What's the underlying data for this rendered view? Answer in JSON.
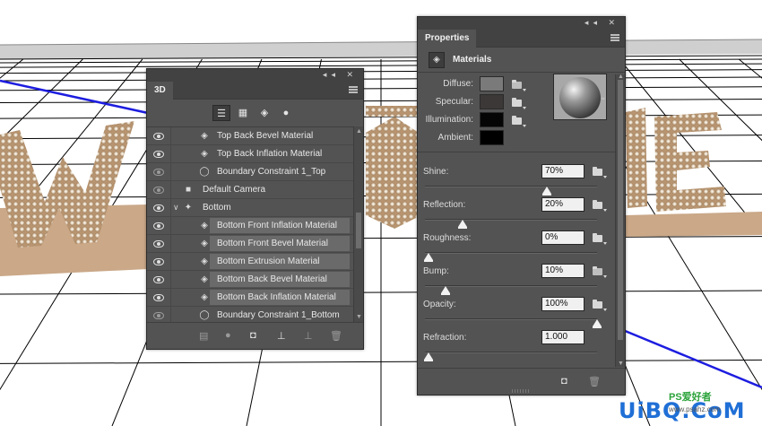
{
  "panel_3d": {
    "tab": "3D",
    "window_controls": "◂◂ ✕",
    "toolbar_icons": [
      "scene-icon",
      "mesh-icon",
      "material-icon",
      "light-icon"
    ],
    "layers": [
      {
        "label": "Top Back Bevel Material",
        "icon": "material-icon",
        "visible": true,
        "selected": false
      },
      {
        "label": "Top Back Inflation Material",
        "icon": "material-icon",
        "visible": true,
        "selected": false
      },
      {
        "label": "Boundary Constraint 1_Top",
        "icon": "constraint-icon",
        "visible": false,
        "selected": false
      },
      {
        "label": "Default Camera",
        "icon": "camera-icon",
        "visible": false,
        "selected": false
      },
      {
        "label": "Bottom",
        "icon": "mesh-icon",
        "visible": true,
        "selected": false,
        "expanded": true
      },
      {
        "label": "Bottom Front Inflation Material",
        "icon": "material-icon",
        "visible": true,
        "selected": true
      },
      {
        "label": "Bottom Front Bevel Material",
        "icon": "material-icon",
        "visible": true,
        "selected": true
      },
      {
        "label": "Bottom Extrusion Material",
        "icon": "material-icon",
        "visible": true,
        "selected": true
      },
      {
        "label": "Bottom Back Bevel Material",
        "icon": "material-icon",
        "visible": true,
        "selected": true
      },
      {
        "label": "Bottom Back Inflation Material",
        "icon": "material-icon",
        "visible": true,
        "selected": true
      },
      {
        "label": "Boundary Constraint 1_Bottom",
        "icon": "constraint-icon",
        "visible": false,
        "selected": false
      }
    ],
    "bottom_icons": [
      "render-icon",
      "light-bulb-icon",
      "new-mesh-icon",
      "ground-icon",
      "add-constraint-icon",
      "delete-icon"
    ]
  },
  "properties": {
    "tab": "Properties",
    "window_controls": "◂◂ ✕",
    "section_title": "Materials",
    "color_props": [
      {
        "label": "Diffuse:",
        "color": "#7a7a7a",
        "has_folder": true,
        "folder_variant": "texture"
      },
      {
        "label": "Specular:",
        "color": "#3b3837",
        "has_folder": true
      },
      {
        "label": "Illumination:",
        "color": "#050505",
        "has_folder": true
      },
      {
        "label": "Ambient:",
        "color": "#000000",
        "has_folder": false
      }
    ],
    "sliders": [
      {
        "label": "Shine:",
        "value": "70%",
        "fraction": 0.7
      },
      {
        "label": "Reflection:",
        "value": "20%",
        "fraction": 0.2
      },
      {
        "label": "Roughness:",
        "value": "0%",
        "fraction": 0.0
      },
      {
        "label": "Bump:",
        "value": "10%",
        "fraction": 0.1
      },
      {
        "label": "Opacity:",
        "value": "100%",
        "fraction": 1.0
      },
      {
        "label": "Refraction:",
        "value": "1.000",
        "fraction": 0.0
      }
    ]
  },
  "watermark": {
    "top_text": "PS爱好者",
    "main_text": "UiBQ.CoM",
    "small_text": "www.psahz.com"
  },
  "colors": {
    "panel_bg": "#535353",
    "panel_dark": "#424242",
    "selected_row": "#6a6a6a",
    "grid_line": "#000000",
    "axis_blue": "#1d1de0",
    "letters": "#d2b48c",
    "base": "#c8a888"
  }
}
